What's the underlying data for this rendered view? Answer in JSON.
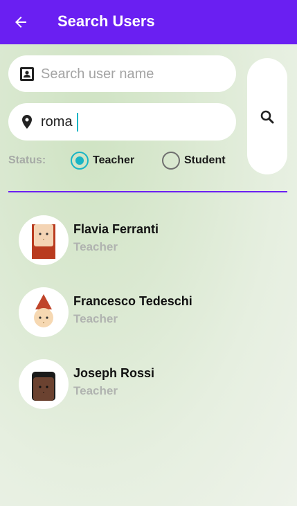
{
  "appbar": {
    "title": "Search Users",
    "back_icon": "arrow-left-icon"
  },
  "search": {
    "name_placeholder": "Search user name",
    "name_value": "",
    "name_icon": "contact-card-icon",
    "city_value": "roma",
    "city_icon": "location-pin-icon",
    "button_icon": "search-icon"
  },
  "status": {
    "label": "Status:",
    "options": [
      {
        "label": "Teacher",
        "selected": true
      },
      {
        "label": "Student",
        "selected": false
      }
    ]
  },
  "users": [
    {
      "name": "Flavia Ferranti",
      "role": "Teacher"
    },
    {
      "name": "Francesco Tedeschi",
      "role": "Teacher"
    },
    {
      "name": "Joseph Rossi",
      "role": "Teacher"
    }
  ],
  "colors": {
    "primary": "#6a1ff2",
    "accent": "#19b5c5"
  }
}
